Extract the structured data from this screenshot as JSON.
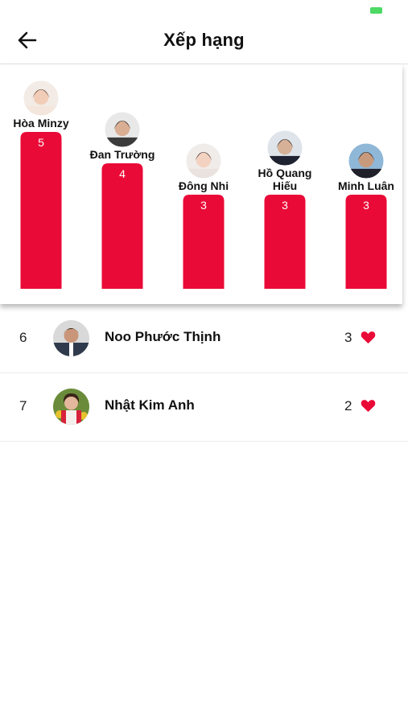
{
  "header": {
    "title": "Xếp hạng"
  },
  "colors": {
    "accent": "#ea0a37",
    "divider": "#e2e2e2"
  },
  "icons": {
    "back": "arrow-left-icon",
    "vote": "heart-icon"
  },
  "chart_data": {
    "type": "bar",
    "categories": [
      "Hòa Minzy",
      "Đan Trường",
      "Đông Nhi",
      "Hồ Quang Hiếu",
      "Minh Luân"
    ],
    "label_lines": [
      [
        "Hòa Minzy"
      ],
      [
        "Đan Trường"
      ],
      [
        "Đông Nhi"
      ],
      [
        "Hồ Quang",
        "Hiếu"
      ],
      [
        "Minh Luân"
      ]
    ],
    "values": [
      5,
      4,
      3,
      3,
      3
    ],
    "ylim": [
      0,
      5
    ]
  },
  "ranking": [
    {
      "rank": "6",
      "name": "Noo Phước Thịnh",
      "votes": "3"
    },
    {
      "rank": "7",
      "name": "Nhật Kim Anh",
      "votes": "2"
    }
  ]
}
